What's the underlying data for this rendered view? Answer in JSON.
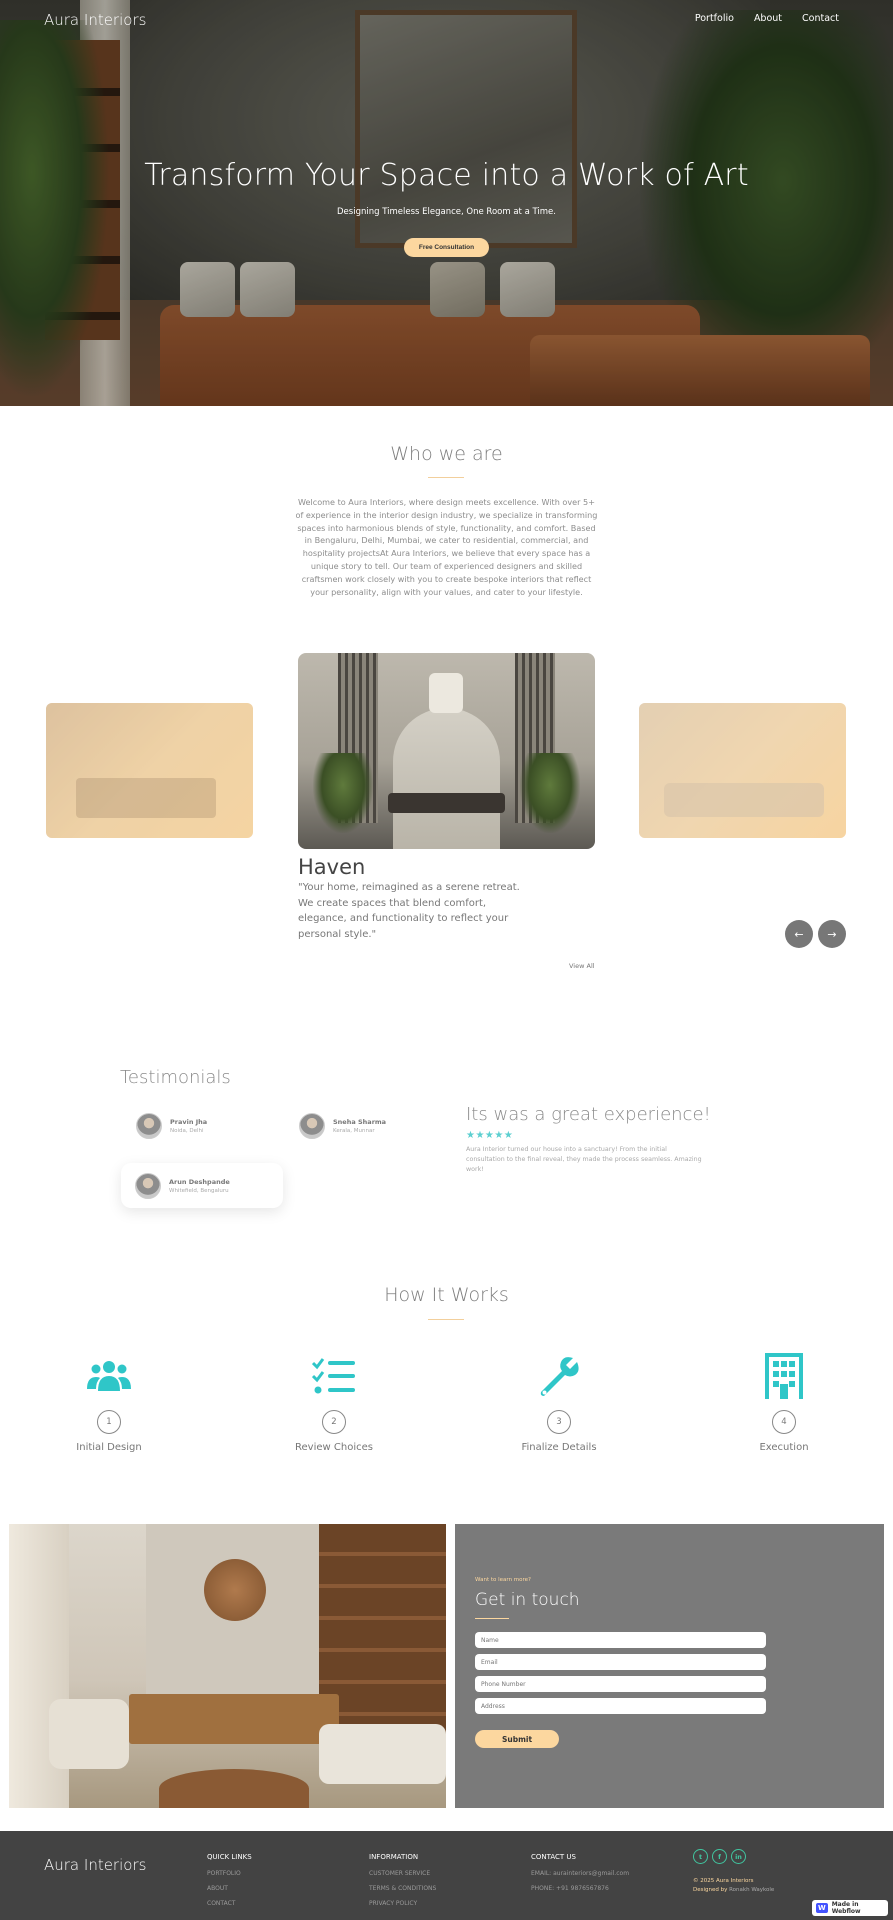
{
  "header": {
    "brand": "Aura Interiors",
    "nav": [
      "Portfolio",
      "About",
      "Contact"
    ]
  },
  "hero": {
    "title": "Transform Your Space into a Work of Art",
    "subtitle": "Designing Timeless Elegance, One Room at a Time.",
    "cta": "Free Consultation"
  },
  "about": {
    "title": "Who we are",
    "text": "Welcome to Aura Interiors, where design meets excellence. With over 5+ of experience in the interior design industry, we specialize in transforming spaces into harmonious blends of style, functionality, and comfort. Based in Bengaluru, Delhi, Mumbai, we cater to residential, commercial, and hospitality projectsAt Aura Interiors, we believe that every space has a unique story to tell. Our team of experienced designers and skilled craftsmen work closely with you to create bespoke interiors that reflect your personality, align with your values, and cater to your lifestyle."
  },
  "carousel": {
    "title": "Haven",
    "quote": "\"Your home, reimagined as a serene retreat. We create spaces that blend comfort, elegance, and functionality to reflect your personal style.\"",
    "prev_icon": "arrow-left-icon",
    "next_icon": "arrow-right-icon",
    "view_all": "View All"
  },
  "testimonials": {
    "title": "Testimonials",
    "people": [
      {
        "name": "Pravin Jha",
        "location": "Noida, Delhi"
      },
      {
        "name": "Sneha Sharma",
        "location": "Kerala, Munnar"
      },
      {
        "name": "Arun Deshpande",
        "location": "Whitefield, Bengaluru"
      }
    ],
    "quote_title": "Its was a great experience!",
    "stars": "★★★★★",
    "quote_text": "Aura Interior turned our house into a sanctuary! From the initial consultation to the final reveal, they made the process seamless. Amazing work!"
  },
  "how": {
    "title": "How It Works",
    "steps": [
      {
        "num": "1",
        "label": "Initial Design",
        "icon": "users-icon"
      },
      {
        "num": "2",
        "label": "Review Choices",
        "icon": "checklist-icon"
      },
      {
        "num": "3",
        "label": "Finalize Details",
        "icon": "wrench-icon"
      },
      {
        "num": "4",
        "label": "Execution",
        "icon": "building-icon"
      }
    ]
  },
  "contact": {
    "kicker": "Want to learn more?",
    "title": "Get in touch",
    "placeholders": {
      "name": "Name",
      "email": "Email",
      "phone": "Phone Number",
      "address": "Address"
    },
    "submit": "Submit"
  },
  "footer": {
    "brand": "Aura Interiors",
    "quick_links": {
      "title": "QUICK LINKS",
      "items": [
        "PORTFOLIO",
        "ABOUT",
        "CONTACT"
      ]
    },
    "information": {
      "title": "INFORMATION",
      "items": [
        "CUSTOMER SERVICE",
        "TERMS & CONDITIONS",
        "PRIVACY POLICY"
      ]
    },
    "contact": {
      "title": "CONTACT US",
      "email": "EMAIL: aurainteriors@gmail.com",
      "phone": "PHONE: +91 9876567876"
    },
    "socials": [
      "twitter-icon",
      "facebook-icon",
      "linkedin-icon"
    ],
    "copyright": "© 2025 Aura Interiors",
    "designed_by_label": "Designed by",
    "designer": "Ronakh Waykole",
    "badge": "Made in Webflow"
  },
  "colors": {
    "accent": "#fcd79f",
    "icon_teal": "#2fc6c8",
    "footer_bg": "#434343",
    "form_bg": "#7a7a7a"
  }
}
